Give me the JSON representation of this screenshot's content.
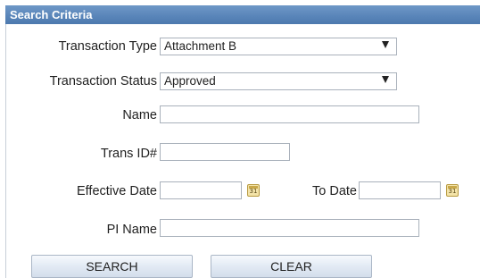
{
  "panel": {
    "title": "Search Criteria"
  },
  "fields": {
    "transaction_type": {
      "label": "Transaction Type",
      "value": "Attachment B"
    },
    "transaction_status": {
      "label": "Transaction Status",
      "value": "Approved"
    },
    "name": {
      "label": "Name",
      "value": ""
    },
    "trans_id": {
      "label": "Trans ID#",
      "value": ""
    },
    "effective_date": {
      "label": "Effective Date",
      "value": ""
    },
    "to_date": {
      "label": "To Date",
      "value": ""
    },
    "pi_name": {
      "label": "PI Name",
      "value": ""
    }
  },
  "icons": {
    "calendar": "calendar-icon",
    "dropdown": "dropdown-arrow-icon",
    "calendar_day": "31"
  },
  "buttons": {
    "search": "SEARCH",
    "clear": "CLEAR"
  },
  "colors": {
    "header_bg": "#5a86ba",
    "header_text": "#ffffff",
    "input_border": "#a9b1bb",
    "button_bg": "#e2eaf4"
  }
}
